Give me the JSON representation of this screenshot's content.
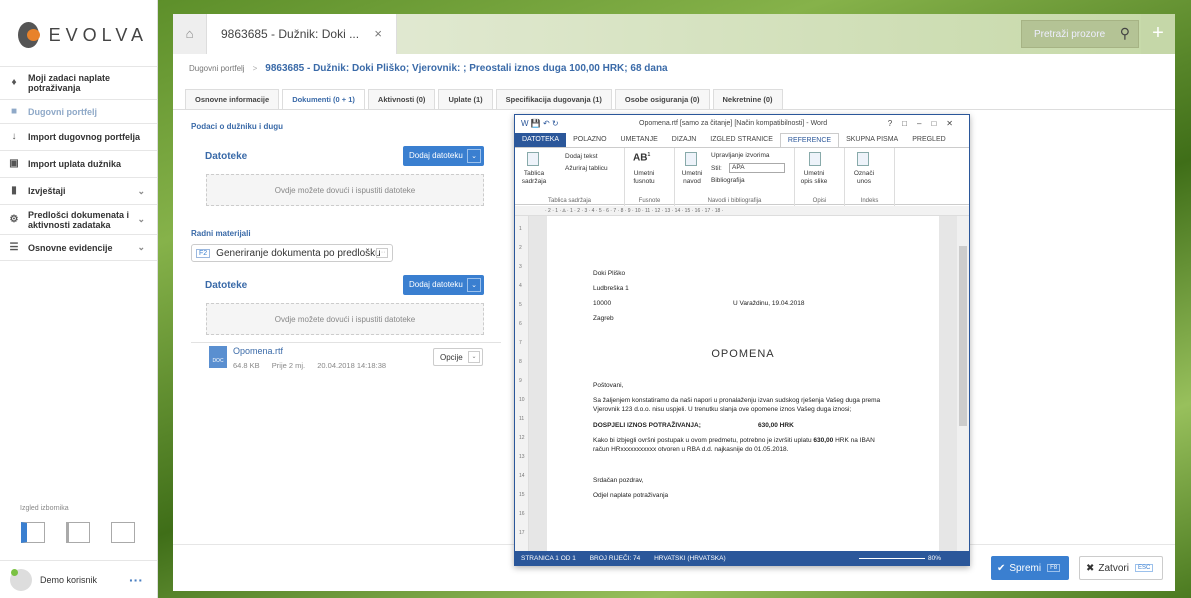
{
  "brand": {
    "name": "EVOLVA"
  },
  "sidebar": {
    "items": [
      {
        "label": "Moji zadaci naplate potraživanja",
        "icon": "bell-icon",
        "expandable": false,
        "active": false
      },
      {
        "label": "Dugovni portfelj",
        "icon": "briefcase-icon",
        "expandable": false,
        "active": true
      },
      {
        "label": "Import dugovnog portfelja",
        "icon": "download-icon",
        "expandable": false,
        "active": false
      },
      {
        "label": "Import uplata dužnika",
        "icon": "money-icon",
        "expandable": false,
        "active": false
      },
      {
        "label": "Izvještaji",
        "icon": "bar-chart-icon",
        "expandable": true,
        "active": false
      },
      {
        "label": "Predlošci dokumenata i aktivnosti zadataka",
        "icon": "gear-icon",
        "expandable": true,
        "active": false
      },
      {
        "label": "Osnovne evidencije",
        "icon": "list-icon",
        "expandable": true,
        "active": false
      }
    ],
    "layout_label": "Izgled izbornika",
    "user_name": "Demo korisnik",
    "user_menu": "···"
  },
  "topbar": {
    "tab_title": "9863685 - Dužnik: Doki ...",
    "search_placeholder": "Pretraži prozore",
    "plus": "+",
    "close": "×"
  },
  "breadcrumb": {
    "root": "Dugovni portfelj",
    "separator": ">",
    "title": "9863685 - Dužnik: Doki Pliško; Vjerovnik: ; Preostali iznos duga 100,00 HRK; 68 dana"
  },
  "tabs": [
    {
      "label": "Osnovne informacije",
      "active": false
    },
    {
      "label": "Dokumenti (0 + 1)",
      "active": true
    },
    {
      "label": "Aktivnosti (0)",
      "active": false
    },
    {
      "label": "Uplate (1)",
      "active": false
    },
    {
      "label": "Specifikacija dugovanja (1)",
      "active": false
    },
    {
      "label": "Osobe osiguranja (0)",
      "active": false
    },
    {
      "label": "Nekretnine (0)",
      "active": false
    }
  ],
  "documents": {
    "section1_title": "Podaci o dužniku i dugu",
    "section2_title": "Radni materijali",
    "files_label": "Datoteke",
    "add_button": "Dodaj datoteku",
    "drop_text": "Ovdje možete dovući i ispustiti datoteke",
    "generate_key": "F2",
    "generate_label": "Generiranje dokumenta po predlošku",
    "generate_more": "···",
    "file": {
      "type": "DOC",
      "name": "Opomena.rtf",
      "size": "64.8 KB",
      "age": "Prije 2 mj.",
      "date": "20.04.2018 14:18:38",
      "options": "Opcije"
    }
  },
  "footer": {
    "save_label": "Spremi",
    "save_key": "F8",
    "close_label": "Zatvori",
    "close_key": "ESC"
  },
  "word": {
    "title": "Opomena.rtf [samo za čitanje] [Način kompatibilnosti] - Word",
    "menu": [
      "DATOTEKA",
      "POLAZNO",
      "UMETANJE",
      "DIZAJN",
      "IZGLED STRANICE",
      "REFERENCE",
      "SKUPNA PISMA",
      "PREGLED"
    ],
    "active_menu": "REFERENCE",
    "ribbon": {
      "toc": "Tablica sadržaja",
      "add_text": "Dodaj tekst",
      "update_table": "Ažuriraj tablicu",
      "group_toc": "Tablica sadržaja",
      "insert_footnote": "Umetni fusnotu",
      "group_footnotes": "Fusnote",
      "insert_citation": "Umetni navod",
      "manage_sources": "Upravljanje izvorima",
      "style_label": "Stil:",
      "style_value": "APA",
      "bibliography": "Bibliografija",
      "group_citations": "Navodi i bibliografija",
      "insert_caption": "Umetni opis slike",
      "group_captions": "Opisi",
      "mark_entry": "Označi unos",
      "group_index": "Indeks"
    },
    "doc": {
      "name": "Doki Pliško",
      "street": "Ludbreška 1",
      "zip": "10000",
      "city": "Zagreb",
      "place_date": "U Varaždinu, 19.04.2018",
      "heading": "OPOMENA",
      "greeting": "Poštovani,",
      "p1_line1": "Sa žaljenjem konstatiramo da naši napori u pronalaženju izvan sudskog rješenja Vašeg duga prema",
      "p1_line2": "Vjerovnik 123 d.o.o.  nisu uspjeli. U trenutku slanja ove opomene iznos Vašeg duga iznosi;",
      "due_label": "DOSPJELI IZNOS POTRAŽIVANJA;",
      "due_amount": "630,00 HRK",
      "p2_line1_a": "Kako bi izbjegli ovršni postupak u ovom predmetu, potrebno je izvršiti uplatu ",
      "p2_amount": "630,00",
      "p2_line1_b": " HRK  na IBAN",
      "p2_line2": "račun HRxxxxxxxxxxx  otvoren u RBA d.d. najkasnije do 01.05.2018.",
      "closing": "Srdačan pozdrav,",
      "signature": "Odjel naplate potraživanja"
    },
    "status": {
      "page": "STRANICA 1 OD 1",
      "words": "BROJ RIJEČI: 74",
      "language": "HRVATSKI (HRVATSKA)",
      "zoom": "80%"
    }
  }
}
